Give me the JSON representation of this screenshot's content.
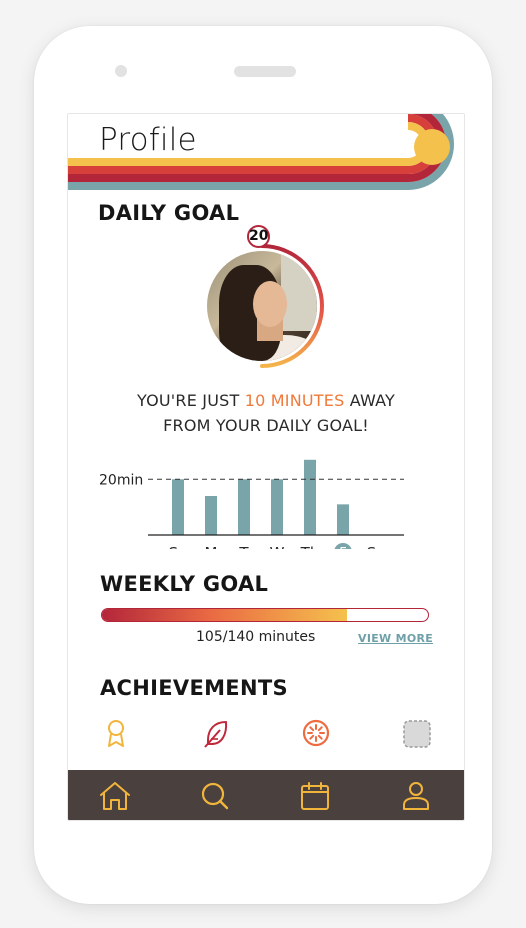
{
  "header": {
    "title": "Profile"
  },
  "daily_goal": {
    "title": "DAILY GOAL",
    "badge_value": "20",
    "progress_fraction": 0.5,
    "message_prefix": "YOU'RE JUST ",
    "message_accent": "10 MINUTES",
    "message_suffix": " AWAY",
    "message_line2": "FROM YOUR DAILY GOAL!"
  },
  "chart_data": {
    "type": "bar",
    "categories": [
      "Su",
      "M",
      "T",
      "W",
      "Th",
      "F",
      "Sa"
    ],
    "values": [
      20,
      14,
      20,
      20,
      27,
      11,
      0
    ],
    "reference_line": {
      "label": "20min",
      "value": 20
    },
    "highlighted_category": "F",
    "ylim": [
      0,
      28
    ],
    "bar_color": "#78a4aa",
    "grid": false
  },
  "weekly_goal": {
    "title": "WEEKLY GOAL",
    "progress_fraction": 0.75,
    "progress_text": "105/140 minutes",
    "view_more_label": "VIEW MORE"
  },
  "achievements": {
    "title": "ACHIEVEMENTS",
    "items": [
      {
        "icon": "ribbon-award-icon",
        "color": "#f2b53c"
      },
      {
        "icon": "feather-icon",
        "color": "#c0283b"
      },
      {
        "icon": "sun-wheel-icon",
        "color": "#ee6a3f"
      },
      {
        "icon": "locked-placeholder-icon",
        "color": "#bdbdbd"
      }
    ]
  },
  "bottom_nav": {
    "items": [
      {
        "icon": "home-icon"
      },
      {
        "icon": "search-icon"
      },
      {
        "icon": "calendar-icon"
      },
      {
        "icon": "user-icon"
      }
    ],
    "icon_color": "#f2b53c",
    "background": "#4a403e"
  },
  "colors": {
    "teal": "#78a4aa",
    "crimson": "#b3263a",
    "red": "#d63f3a",
    "orange": "#ee6a3f",
    "yellow": "#f5c14d"
  }
}
